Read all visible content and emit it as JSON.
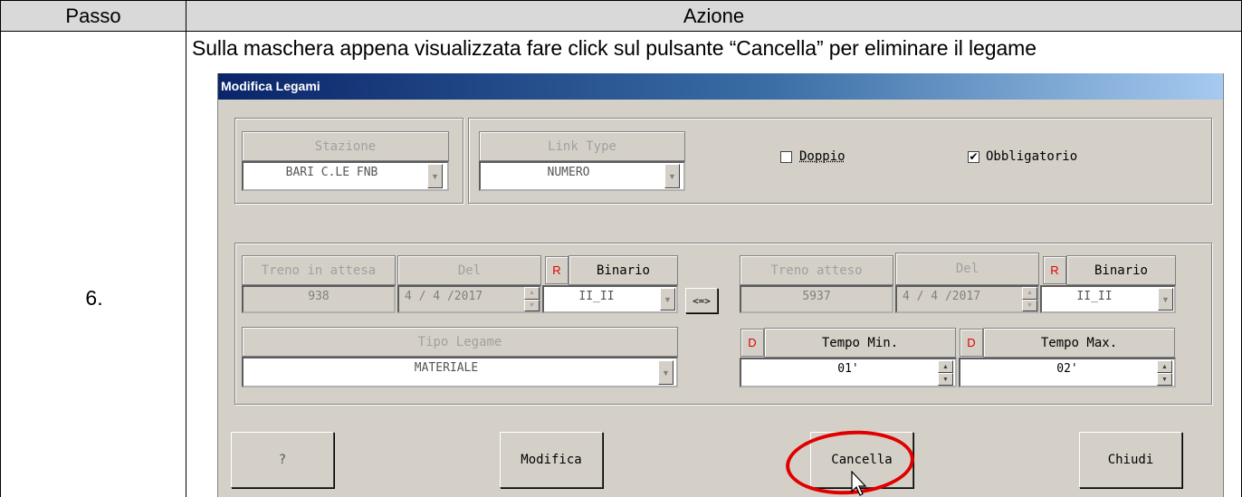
{
  "table": {
    "col_passo": "Passo",
    "col_azione": "Azione",
    "step": "6.",
    "instruction": "Sulla maschera appena visualizzata fare click sul pulsante “Cancella” per eliminare il legame"
  },
  "dialog": {
    "title": "Modifica Legami",
    "stazione": {
      "label": "Stazione",
      "value": "BARI C.LE FNB"
    },
    "link_type": {
      "label": "Link Type",
      "value": "NUMERO"
    },
    "doppio": {
      "label": "Doppio",
      "checked": false
    },
    "obbligatorio": {
      "label": "Obbligatorio",
      "checked": true,
      "mark": "✔"
    },
    "left_train": {
      "label": "Treno in attesa",
      "value": "938",
      "del_label": "Del",
      "del_value": "4 / 4 /2017",
      "r": "R",
      "binario_label": "Binario",
      "binario_value": "II_II"
    },
    "swap_button": "<=>",
    "right_train": {
      "label": "Treno atteso",
      "value": "5937",
      "del_label": "Del",
      "del_value": "4 / 4 /2017",
      "r": "R",
      "binario_label": "Binario",
      "binario_value": "II_II"
    },
    "tipo_legame": {
      "label": "Tipo Legame",
      "value": "MATERIALE"
    },
    "tempo_min": {
      "d": "D",
      "label": "Tempo Min.",
      "value": "01'"
    },
    "tempo_max": {
      "d": "D",
      "label": "Tempo Max.",
      "value": "02'"
    },
    "buttons": {
      "help": "?",
      "modifica": "Modifica",
      "cancella": "Cancella",
      "chiudi": "Chiudi"
    }
  },
  "colors": {
    "highlight": "#e00000",
    "titlebar": "#0a246a",
    "dialog_bg": "#d4d0c8"
  }
}
